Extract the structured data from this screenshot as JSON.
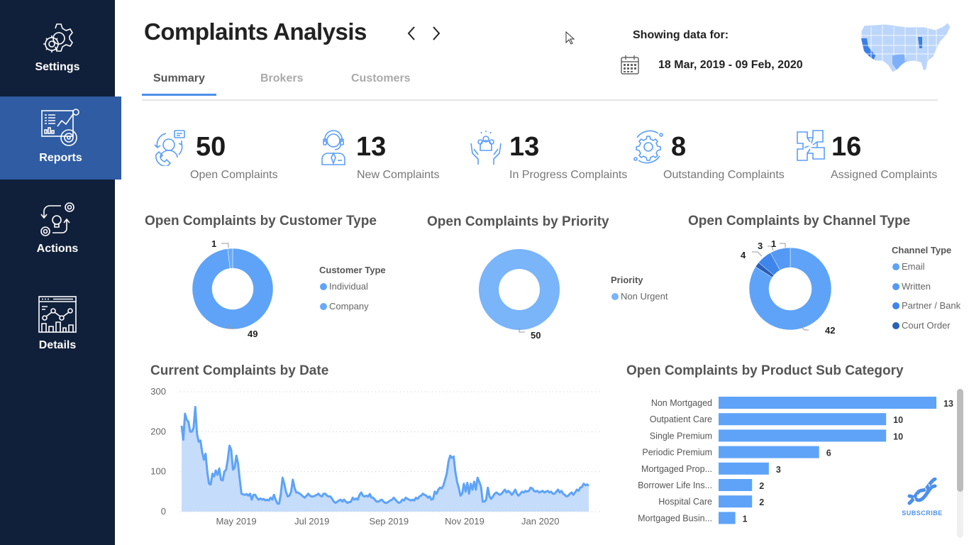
{
  "sidebar": {
    "items": [
      {
        "label": "Settings",
        "icon": "gears-icon",
        "active": false
      },
      {
        "label": "Reports",
        "icon": "report-dashboard-icon",
        "active": true
      },
      {
        "label": "Actions",
        "icon": "process-idea-icon",
        "active": false
      },
      {
        "label": "Details",
        "icon": "analytics-window-icon",
        "active": false
      }
    ]
  },
  "header": {
    "title": "Complaints Analysis",
    "prev_icon": "chevron-left-icon",
    "next_icon": "chevron-right-icon",
    "showing_label": "Showing data for:",
    "date_range": "18 Mar, 2019 - 09 Feb, 2020"
  },
  "tabs": [
    {
      "label": "Summary",
      "active": true
    },
    {
      "label": "Brokers",
      "active": false
    },
    {
      "label": "Customers",
      "active": false
    }
  ],
  "kpis": [
    {
      "value": "50",
      "label": "Open Complaints",
      "icon": "support-call-icon"
    },
    {
      "value": "13",
      "label": "New Complaints",
      "icon": "agent-headset-icon"
    },
    {
      "value": "13",
      "label": "In Progress Complaints",
      "icon": "team-hands-icon"
    },
    {
      "value": "8",
      "label": "Outstanding Complaints",
      "icon": "cycle-gear-icon"
    },
    {
      "value": "16",
      "label": "Assigned Complaints",
      "icon": "joined-hands-icon"
    }
  ],
  "colors": {
    "sidebar_bg": "#11203a",
    "sidebar_active": "#2f5ca2",
    "accent": "#4e8fe9",
    "series_light": "#5ea3f7",
    "series_priority": "#7ab4f9",
    "series_mid": "#4a8ff0",
    "series_dark": "#2960b8",
    "area_fill": "#c6dcfb"
  },
  "subscribe_label": "SUBSCRIBE",
  "chart_data": [
    {
      "type": "pie",
      "variant": "donut",
      "title": "Open Complaints by Customer Type",
      "legend_title": "Customer Type",
      "legend_position": "right",
      "slices": [
        {
          "label": "Individual",
          "value": 49,
          "color": "#5ea3f7"
        },
        {
          "label": "Company",
          "value": 1,
          "color": "#6aaaf7"
        }
      ]
    },
    {
      "type": "pie",
      "variant": "donut",
      "title": "Open Complaints by Priority",
      "legend_title": "Priority",
      "legend_position": "right",
      "slices": [
        {
          "label": "Non Urgent",
          "value": 50,
          "color": "#7ab4f9"
        }
      ]
    },
    {
      "type": "pie",
      "variant": "donut",
      "title": "Open Complaints by Channel Type",
      "legend_title": "Channel Type",
      "legend_position": "right",
      "slices": [
        {
          "label": "Email",
          "value": 42,
          "color": "#5ea3f7"
        },
        {
          "label": "Written",
          "value": 4,
          "color": "#5499f3"
        },
        {
          "label": "Partner / Bank",
          "value": 3,
          "color": "#3f86ec"
        },
        {
          "label": "Court Order",
          "value": 1,
          "color": "#2960b8"
        }
      ]
    },
    {
      "type": "area",
      "title": "Current Complaints by Date",
      "xlabel": "",
      "ylabel": "",
      "ylim": [
        0,
        300
      ],
      "yticks": [
        0,
        100,
        200,
        300
      ],
      "xticks": [
        "May 2019",
        "Jul 2019",
        "Sep 2019",
        "Nov 2019",
        "Jan 2020"
      ],
      "x_range": [
        "2019-03-18",
        "2020-02-09"
      ],
      "grid": true,
      "series": [
        {
          "name": "Current Complaints",
          "values": [
            215,
            180,
            245,
            230,
            225,
            200,
            200,
            210,
            262,
            195,
            175,
            178,
            150,
            130,
            145,
            100,
            70,
            68,
            95,
            88,
            103,
            92,
            108,
            80,
            78,
            100,
            105,
            130,
            165,
            155,
            105,
            110,
            140,
            120,
            80,
            45,
            43,
            42,
            44,
            40,
            45,
            30,
            42,
            42,
            35,
            30,
            33,
            30,
            32,
            28,
            30,
            28,
            35,
            30,
            42,
            30,
            20,
            20,
            45,
            85,
            70,
            50,
            38,
            40,
            50,
            80,
            60,
            48,
            48,
            45,
            42,
            38,
            35,
            40,
            45,
            40,
            38,
            38,
            40,
            42,
            45,
            40,
            38,
            45,
            45,
            40,
            38,
            38,
            32,
            25,
            22,
            25,
            28,
            30,
            25,
            30,
            25,
            22,
            24,
            25,
            35,
            30,
            33,
            30,
            42,
            48,
            40,
            38,
            40,
            38,
            44,
            35,
            35,
            30,
            25,
            25,
            28,
            30,
            25,
            22,
            22,
            25,
            28,
            30,
            35,
            30,
            25,
            22,
            24,
            30,
            28,
            35,
            32,
            30,
            28,
            30,
            28,
            35,
            32,
            38,
            40,
            45,
            42,
            40,
            35,
            38,
            30,
            32,
            50,
            45,
            55,
            60,
            58,
            65,
            80,
            95,
            125,
            140,
            135,
            138,
            100,
            75,
            60,
            40,
            45,
            70,
            50,
            72,
            45,
            70,
            55,
            75,
            55,
            85,
            75,
            62,
            25,
            25,
            30,
            60,
            38,
            32,
            38,
            45,
            48,
            45,
            42,
            45,
            50,
            55,
            48,
            52,
            48,
            42,
            48,
            55,
            45,
            40,
            45,
            50,
            48,
            52,
            50,
            52,
            60,
            58,
            52,
            50,
            52,
            48,
            50,
            52,
            48,
            50,
            52,
            48,
            50,
            45,
            45,
            50,
            55,
            48,
            52,
            45,
            42,
            38,
            40,
            45,
            48,
            42,
            48,
            55,
            52,
            60,
            62,
            70,
            66,
            68,
            65
          ]
        }
      ]
    },
    {
      "type": "bar",
      "orientation": "horizontal",
      "title": "Open Complaints by Product Sub Category",
      "categories": [
        "Non Mortgaged",
        "Outpatient Care",
        "Single Premium",
        "Periodic Premium",
        "Mortgaged Prop...",
        "Borrower Life Ins...",
        "Hospital Care",
        "Mortgaged Busin..."
      ],
      "values": [
        13,
        10,
        10,
        6,
        3,
        2,
        2,
        1
      ],
      "xlim": [
        0,
        13
      ],
      "color": "#5ea3f7"
    }
  ]
}
